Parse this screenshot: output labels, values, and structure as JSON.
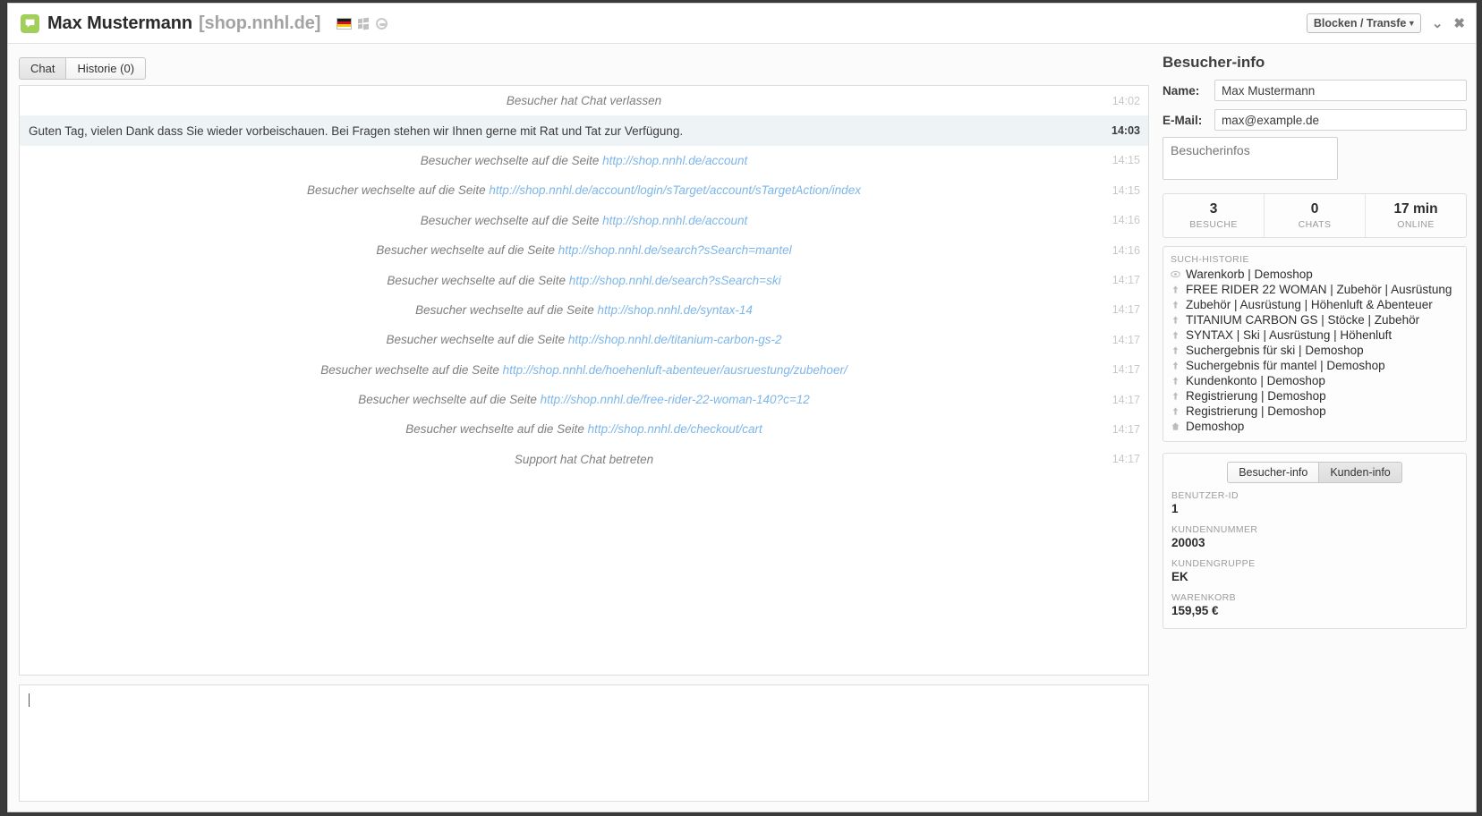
{
  "titlebar": {
    "name": "Max Mustermann",
    "domain": "[shop.nnhl.de]",
    "flag_icon": "german-flag-icon",
    "os_icon": "windows-icon",
    "browser_icon": "browser-icon",
    "action_select": "Blocken / Transfe",
    "action_caret": "▼",
    "minimize": "⌄",
    "close": "✖"
  },
  "tabs": [
    {
      "label": "Chat",
      "active": true
    },
    {
      "label": "Historie (0)",
      "active": false
    }
  ],
  "chat": {
    "messages": [
      {
        "kind": "system",
        "text": "Besucher hat Chat verlassen",
        "link": "",
        "time": "14:02"
      },
      {
        "kind": "agent",
        "text": "Guten Tag, vielen Dank dass Sie wieder vorbeischauen. Bei Fragen stehen wir Ihnen gerne mit Rat und Tat zur Verfügung.",
        "link": "",
        "time": "14:03"
      },
      {
        "kind": "system",
        "text": "Besucher wechselte auf die Seite ",
        "link": "http://shop.nnhl.de/account",
        "time": "14:15"
      },
      {
        "kind": "system",
        "text": "Besucher wechselte auf die Seite ",
        "link": "http://shop.nnhl.de/account/login/sTarget/account/sTargetAction/index",
        "time": "14:15"
      },
      {
        "kind": "system",
        "text": "Besucher wechselte auf die Seite ",
        "link": "http://shop.nnhl.de/account",
        "time": "14:16"
      },
      {
        "kind": "system",
        "text": "Besucher wechselte auf die Seite ",
        "link": "http://shop.nnhl.de/search?sSearch=mantel",
        "time": "14:16"
      },
      {
        "kind": "system",
        "text": "Besucher wechselte auf die Seite ",
        "link": "http://shop.nnhl.de/search?sSearch=ski",
        "time": "14:17"
      },
      {
        "kind": "system",
        "text": "Besucher wechselte auf die Seite ",
        "link": "http://shop.nnhl.de/syntax-14",
        "time": "14:17"
      },
      {
        "kind": "system",
        "text": "Besucher wechselte auf die Seite ",
        "link": "http://shop.nnhl.de/titanium-carbon-gs-2",
        "time": "14:17"
      },
      {
        "kind": "system",
        "text": "Besucher wechselte auf die Seite ",
        "link": "http://shop.nnhl.de/hoehenluft-abenteuer/ausruestung/zubehoer/",
        "time": "14:17"
      },
      {
        "kind": "system",
        "text": "Besucher wechselte auf die Seite ",
        "link": "http://shop.nnhl.de/free-rider-22-woman-140?c=12",
        "time": "14:17"
      },
      {
        "kind": "system",
        "text": "Besucher wechselte auf die Seite ",
        "link": "http://shop.nnhl.de/checkout/cart",
        "time": "14:17"
      },
      {
        "kind": "system",
        "text": "Support hat Chat betreten",
        "link": "",
        "time": "14:17"
      }
    ],
    "input_value": ""
  },
  "sidebar": {
    "heading": "Besucher-info",
    "name_label": "Name:",
    "name_value": "Max Mustermann",
    "email_label": "E-Mail:",
    "email_value": "max@example.de",
    "notes_placeholder": "Besucherinfos",
    "notes_value": "",
    "stats": [
      {
        "value": "3",
        "label": "BESUCHE"
      },
      {
        "value": "0",
        "label": "CHATS"
      },
      {
        "value": "17 min",
        "label": "ONLINE"
      }
    ],
    "history_title": "SUCH-HISTORIE",
    "history": [
      {
        "icon": "eye-icon",
        "text": "Warenkorb | Demoshop"
      },
      {
        "icon": "arrow-up-icon",
        "text": "FREE RIDER 22 WOMAN | Zubehör | Ausrüstung"
      },
      {
        "icon": "arrow-up-icon",
        "text": "Zubehör | Ausrüstung | Höhenluft & Abenteuer"
      },
      {
        "icon": "arrow-up-icon",
        "text": "TITANIUM CARBON GS | Stöcke | Zubehör"
      },
      {
        "icon": "arrow-up-icon",
        "text": "SYNTAX | Ski | Ausrüstung | Höhenluft"
      },
      {
        "icon": "arrow-up-icon",
        "text": "Suchergebnis für ski | Demoshop"
      },
      {
        "icon": "arrow-up-icon",
        "text": "Suchergebnis für mantel | Demoshop"
      },
      {
        "icon": "arrow-up-icon",
        "text": "Kundenkonto | Demoshop"
      },
      {
        "icon": "arrow-up-icon",
        "text": "Registrierung | Demoshop"
      },
      {
        "icon": "arrow-up-icon",
        "text": "Registrierung | Demoshop"
      },
      {
        "icon": "home-icon",
        "text": "Demoshop"
      }
    ],
    "seg_visitor": "Besucher-info",
    "seg_customer": "Kunden-info",
    "customer": [
      {
        "key": "BENUTZER-ID",
        "value": "1"
      },
      {
        "key": "KUNDENNUMMER",
        "value": "20003"
      },
      {
        "key": "KUNDENGRUPPE",
        "value": "EK"
      },
      {
        "key": "WARENKORB",
        "value": "159,95 €"
      }
    ]
  }
}
